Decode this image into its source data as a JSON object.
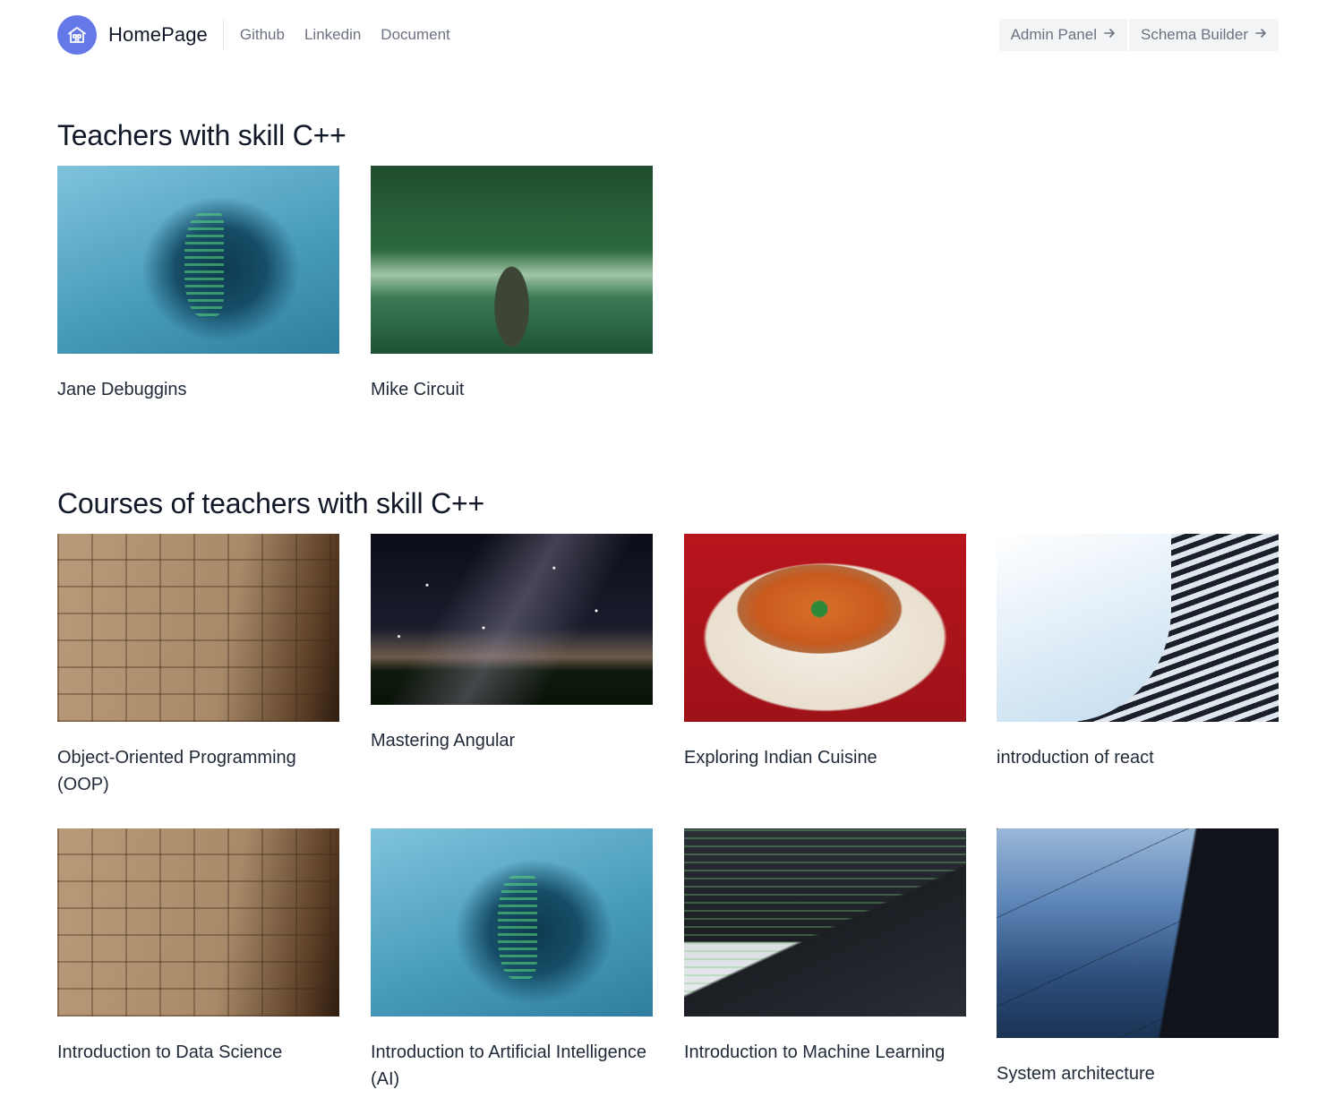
{
  "header": {
    "brand": "HomePage",
    "nav": [
      {
        "label": "Github"
      },
      {
        "label": "Linkedin"
      },
      {
        "label": "Document"
      }
    ],
    "actions": [
      {
        "label": "Admin Panel",
        "icon": "arrow-right-icon"
      },
      {
        "label": "Schema Builder",
        "icon": "arrow-right-icon"
      }
    ],
    "accent_color": "#6578e8"
  },
  "teachers": {
    "title": "Teachers with skill C++",
    "items": [
      {
        "name": "Jane Debuggins",
        "image": "code-projected-face-photo"
      },
      {
        "name": "Mike Circuit",
        "image": "man-by-lake-photo"
      }
    ]
  },
  "courses": {
    "title": "Courses of teachers with skill C++",
    "items": [
      {
        "name": "Object-Oriented Programming (OOP)",
        "image": "file-drawers-photo"
      },
      {
        "name": "Mastering Angular",
        "image": "milky-way-photo"
      },
      {
        "name": "Exploring Indian Cuisine",
        "image": "curry-naan-photo"
      },
      {
        "name": "introduction of react",
        "image": "curved-building-photo"
      },
      {
        "name": "Introduction to Data Science",
        "image": "file-drawers-photo"
      },
      {
        "name": "Introduction to Artificial Intelligence (AI)",
        "image": "code-projected-face-photo"
      },
      {
        "name": "Introduction to Machine Learning",
        "image": "laptop-code-photo"
      },
      {
        "name": "System architecture",
        "image": "glass-building-photo"
      }
    ]
  }
}
